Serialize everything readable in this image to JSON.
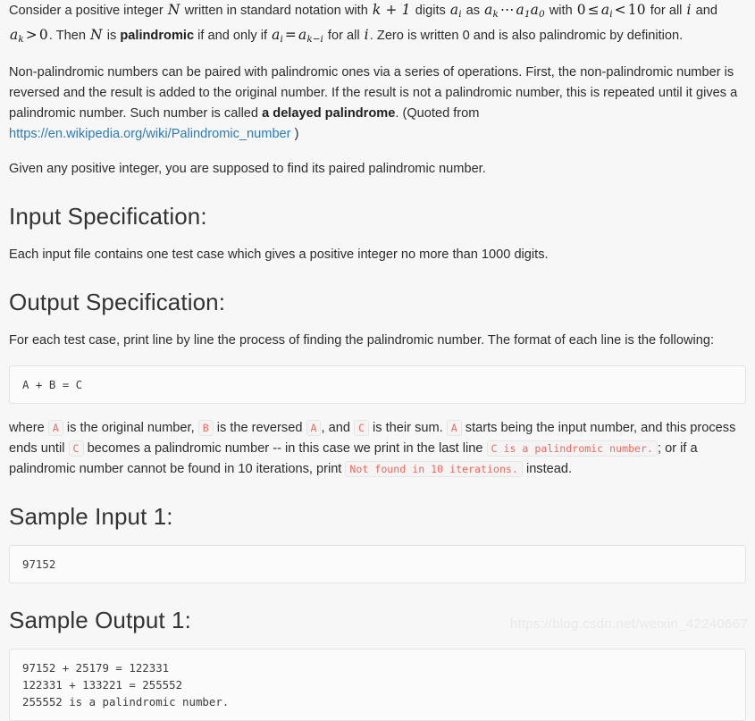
{
  "intro": {
    "p1_part1": "Consider a positive integer ",
    "p1_math_N": "N",
    "p1_part2": " written in standard notation with ",
    "p1_math_k1": "k + 1",
    "p1_part3": " digits ",
    "p1_math_ai": "a",
    "p1_math_ai_sub": "i",
    "p1_part4": " as ",
    "p1_math_ak": "a",
    "p1_math_ak_sub": "k",
    "p1_math_dots": "⋯",
    "p1_math_a1": "a",
    "p1_math_a1_sub": "1",
    "p1_math_a0": "a",
    "p1_math_a0_sub": "0",
    "p1_part5": " with ",
    "p1_math_range_0": "0",
    "p1_math_range_le": "≤",
    "p1_math_range_a": "a",
    "p1_math_range_a_sub": "i",
    "p1_math_range_lt": "<",
    "p1_math_range_10": "10",
    "p1_part6": " for all ",
    "p1_math_i": "i",
    "p1_part7": " and ",
    "p1_math_ak2": "a",
    "p1_math_ak2_sub": "k",
    "p1_math_gt": ">",
    "p1_math_zero": "0",
    "p1_part8": ". Then ",
    "p1_math_N2": "N",
    "p1_part9": " is ",
    "p1_bold": "palindromic",
    "p1_part10": " if and only if ",
    "p1_math_eq_a": "a",
    "p1_math_eq_a_sub": "i",
    "p1_math_eq": "=",
    "p1_math_eq_b": "a",
    "p1_math_eq_b_sub": "k−i",
    "p1_part11": " for all ",
    "p1_math_i2": "i",
    "p1_part12": ". Zero is written 0 and is also palindromic by definition.",
    "p2_part1": "Non-palindromic numbers can be paired with palindromic ones via a series of operations. First, the non-palindromic number is reversed and the result is added to the original number. If the result is not a palindromic number, this is repeated until it gives a palindromic number. Such number is called ",
    "p2_bold": "a delayed palindrome",
    "p2_part2": ". (Quoted from ",
    "p2_link": "https://en.wikipedia.org/wiki/Palindromic_number",
    "p2_part3": " )",
    "p3": "Given any positive integer, you are supposed to find its paired palindromic number."
  },
  "input_spec": {
    "heading": "Input Specification:",
    "body": "Each input file contains one test case which gives a positive integer no more than 1000 digits."
  },
  "output_spec": {
    "heading": "Output Specification:",
    "body_part1": "For each test case, print line by line the process of finding the palindromic number. The format of each line is the following:",
    "format_code": "A + B = C",
    "where_part1": "where ",
    "where_code_a1": "A",
    "where_part2": " is the original number, ",
    "where_code_b": "B",
    "where_part3": " is the reversed ",
    "where_code_a2": "A",
    "where_part4": ", and ",
    "where_code_c1": "C",
    "where_part5": " is their sum. ",
    "where_code_a3": "A",
    "where_part6": " starts being the input number, and this process ends until ",
    "where_code_c2": "C",
    "where_part7": " becomes a palindromic number -- in this case we print in the last line ",
    "where_code_palin": "C is a palindromic number.",
    "where_part8": "; or if a palindromic number cannot be found in 10 iterations, print ",
    "where_code_notfound": "Not found in 10 iterations.",
    "where_part9": " instead."
  },
  "sample_input": {
    "heading": "Sample Input 1:",
    "code": "97152"
  },
  "sample_output": {
    "heading": "Sample Output 1:",
    "code": "97152 + 25179 = 122331\n122331 + 133221 = 255552\n255552 is a palindromic number."
  },
  "watermark": {
    "text": "https://blog.csdn.net/weixin_42240667"
  },
  "colors": {
    "page_background": "#f7f7f7",
    "body_text": "#2c2c2c",
    "heading": "#333333",
    "link": "#2b7bb9",
    "inline_code_text": "#ec6a5e",
    "inline_code_background": "#f4f4f4",
    "code_block_background": "#fbfbfb",
    "code_block_border": "#e3e3e3",
    "watermark": "#e9e9e9"
  }
}
